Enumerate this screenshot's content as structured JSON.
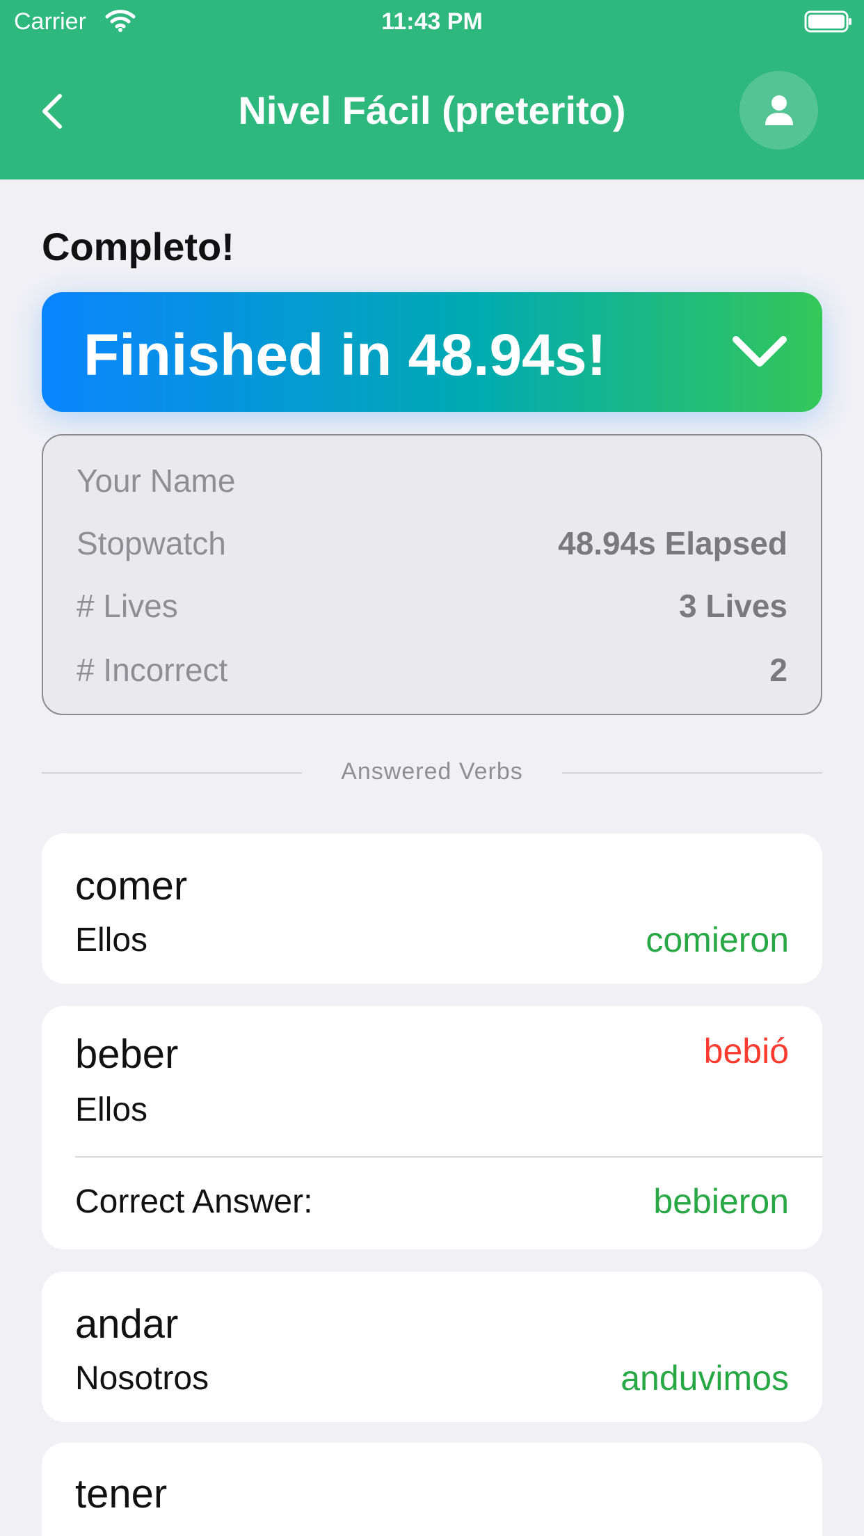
{
  "status_bar": {
    "carrier": "Carrier",
    "time": "11:43 PM"
  },
  "nav": {
    "title": "Nivel Fácil (preterito)"
  },
  "heading": "Completo!",
  "banner": {
    "text": "Finished in 48.94s!"
  },
  "stats": {
    "name_placeholder": "Your Name",
    "rows": [
      {
        "label": "Stopwatch",
        "value": "48.94s Elapsed"
      },
      {
        "label": "# Lives",
        "value": "3 Lives"
      },
      {
        "label": "# Incorrect",
        "value": "2"
      }
    ]
  },
  "section_label": "Answered Verbs",
  "verbs": [
    {
      "verb": "comer",
      "subject": "Ellos",
      "answer": "comieron",
      "correct": true
    },
    {
      "verb": "beber",
      "subject": "Ellos",
      "answer": "bebió",
      "correct": false,
      "correct_label": "Correct Answer:",
      "correct_answer": "bebieron"
    },
    {
      "verb": "andar",
      "subject": "Nosotros",
      "answer": "anduvimos",
      "correct": true
    },
    {
      "verb": "tener",
      "subject": "",
      "answer": "",
      "correct": true
    }
  ],
  "colors": {
    "header": "#2fb87d",
    "correct": "#28a745",
    "incorrect": "#ff3b30",
    "background": "#f0f0f5"
  }
}
